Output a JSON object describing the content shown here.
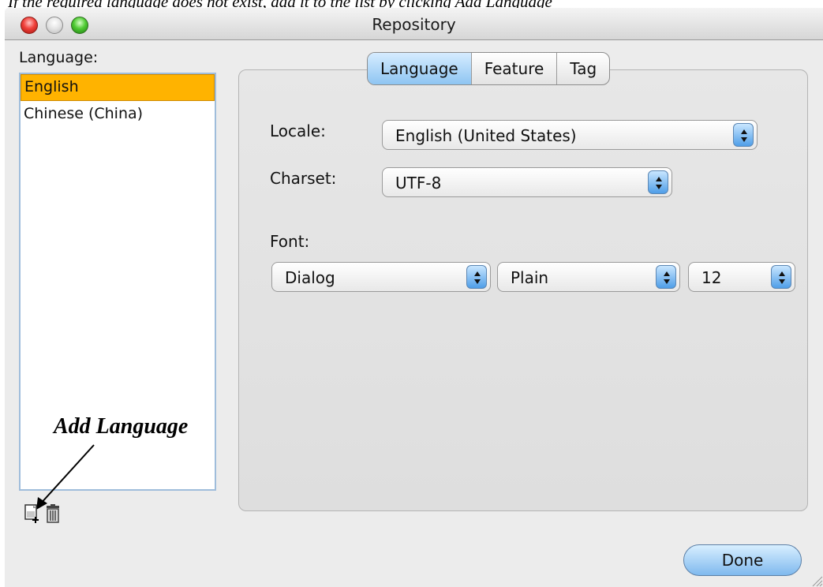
{
  "overlay_caption": "If the required language does not exist, add it to the list by clicking Add Language",
  "window": {
    "title": "Repository"
  },
  "language_panel": {
    "label": "Language:",
    "items": [
      {
        "label": "English",
        "selected": true
      },
      {
        "label": "Chinese (China)",
        "selected": false
      }
    ],
    "add_icon": "add-document-icon",
    "delete_icon": "trash-icon"
  },
  "annotation": {
    "text": "Add Language"
  },
  "tabs": [
    {
      "label": "Language",
      "active": true
    },
    {
      "label": "Feature",
      "active": false
    },
    {
      "label": "Tag",
      "active": false
    }
  ],
  "form": {
    "locale_label": "Locale:",
    "locale_value": "English (United States)",
    "charset_label": "Charset:",
    "charset_value": "UTF-8",
    "font_label": "Font:",
    "font_family_value": "Dialog",
    "font_style_value": "Plain",
    "font_size_value": "12"
  },
  "buttons": {
    "done_label": "Done"
  },
  "colors": {
    "selection": "#ffb300",
    "accent_blue": "#7fb9ee",
    "close_light": "#f0403a",
    "zoom_light": "#4fcb33"
  }
}
